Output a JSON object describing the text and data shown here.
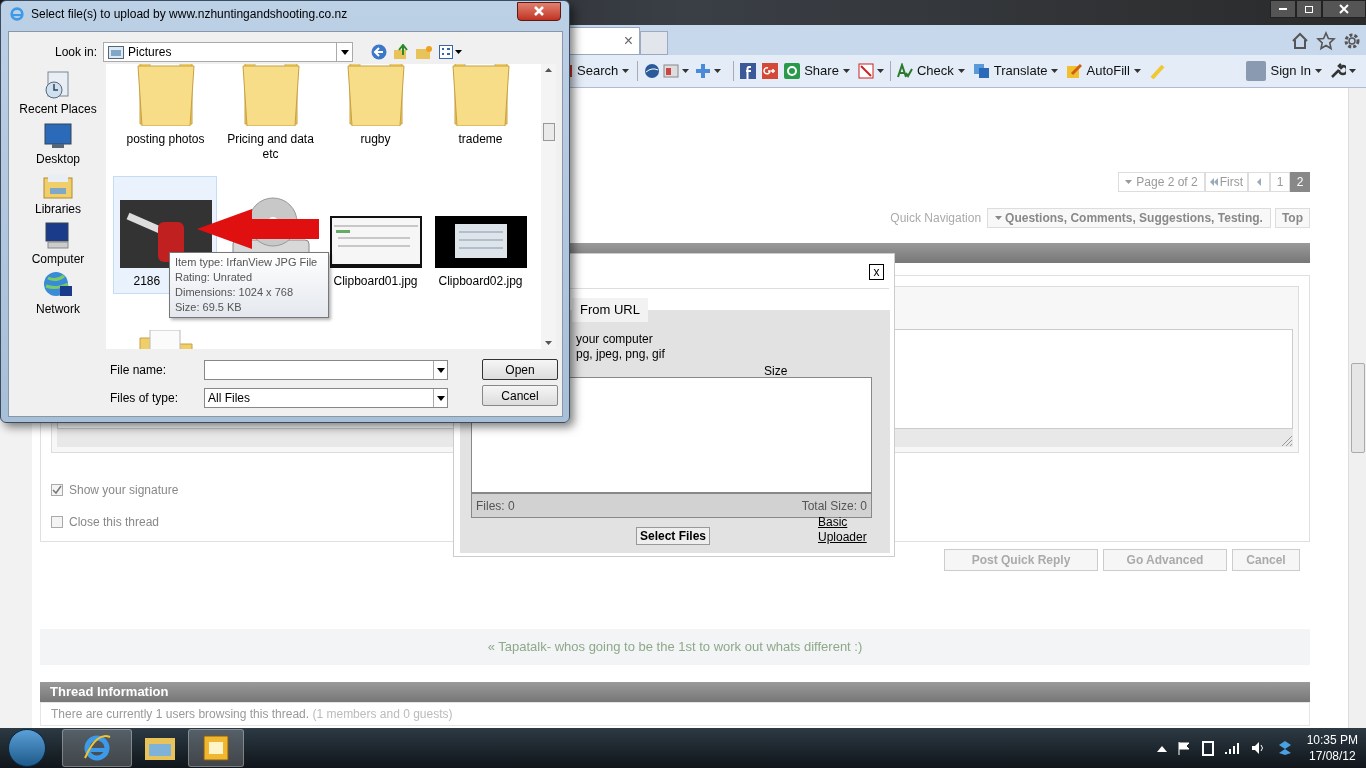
{
  "browser": {
    "tab_close": "×",
    "toolbar": [
      "Search",
      "Share",
      "Check",
      "Translate",
      "AutoFill",
      "Sign In"
    ]
  },
  "page": {
    "pagination": {
      "label": "Page 2 of 2",
      "first": "First",
      "pages": [
        {
          "label": "1",
          "selected": false
        },
        {
          "label": "2",
          "selected": true
        }
      ]
    },
    "quick_navigation": {
      "label": "Quick Navigation",
      "value": "Questions, Comments, Suggestions, Testing.",
      "top": "Top"
    },
    "options": [
      {
        "label": "Show your signature",
        "checked": true
      },
      {
        "label": "Close this thread",
        "checked": false
      }
    ],
    "buttons": [
      "Post Quick Reply",
      "Go Advanced",
      "Cancel"
    ],
    "thread_link": "« Tapatalk- whos going to be the 1st to work out whats different :)",
    "thread_info": {
      "title": "Thread Information",
      "text": "There are currently 1 users browsing this thread.",
      "note": "(1 members and 0 guests)"
    }
  },
  "upload_popup": {
    "close": "x",
    "tab": "From URL",
    "lines": [
      "your computer",
      "pg, jpeg, png, gif"
    ],
    "size_header": "Size",
    "files": "Files: 0",
    "total": "Total Size: 0",
    "select": "Select Files",
    "basic": "Basic Uploader"
  },
  "file_dialog": {
    "title": "Select file(s) to upload by www.nzhuntingandshooting.co.nz",
    "look_in": {
      "label": "Look in:",
      "value": "Pictures"
    },
    "places": [
      "Recent Places",
      "Desktop",
      "Libraries",
      "Computer",
      "Network"
    ],
    "files": [
      {
        "kind": "folder",
        "label": "posting photos",
        "selected": false
      },
      {
        "kind": "folder",
        "label": "Pricing and data etc",
        "selected": false
      },
      {
        "kind": "folder",
        "label": "rugby",
        "selected": false
      },
      {
        "kind": "folder",
        "label": "trademe",
        "selected": false
      },
      {
        "kind": "photo",
        "label": "2186",
        "selected": true
      },
      {
        "kind": "disc",
        "selected": false
      },
      {
        "kind": "screenshot",
        "label": "Clipboard01.jpg",
        "selected": false
      },
      {
        "kind": "screenshot-dark",
        "label": "Clipboard02.jpg",
        "selected": false
      },
      {
        "kind": "folder",
        "selected": false
      }
    ],
    "tooltip": [
      "Item type: IrfanView JPG File",
      "Rating: Unrated",
      "Dimensions: 1024 x 768",
      "Size: 69.5 KB"
    ],
    "file_name": {
      "label": "File name:"
    },
    "file_type": {
      "label": "Files of type:",
      "value": "All Files"
    },
    "buttons": [
      "Open",
      "Cancel"
    ]
  },
  "taskbar": {
    "time": "10:35 PM",
    "date": "17/08/12"
  }
}
